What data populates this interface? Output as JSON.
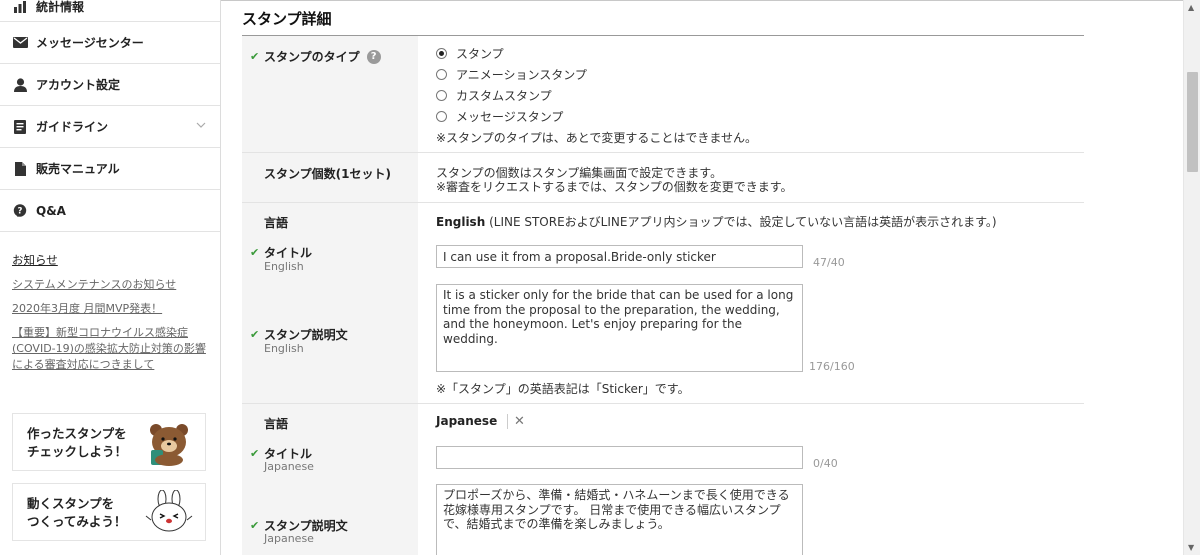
{
  "sidebar": {
    "items": [
      {
        "label": "統計情報",
        "icon": "chart-icon"
      },
      {
        "label": "メッセージセンター",
        "icon": "envelope-icon"
      },
      {
        "label": "アカウント設定",
        "icon": "user-icon"
      },
      {
        "label": "ガイドライン",
        "icon": "document-icon"
      },
      {
        "label": "販売マニュアル",
        "icon": "file-icon"
      },
      {
        "label": "Q&A",
        "icon": "qa-bubble-icon"
      }
    ],
    "notice_title": "お知らせ",
    "notices": [
      "システムメンテナンスのお知らせ",
      "2020年3月度 月間MVP発表！",
      "【重要】新型コロナウイルス感染症(COVID-19)の感染拡大防止対策の影響による審査対応につきまして"
    ],
    "promos": [
      {
        "line1": "作ったスタンプを",
        "line2": "チェックしよう！"
      },
      {
        "line1": "動くスタンプを",
        "line2": "つくってみよう！"
      }
    ]
  },
  "main": {
    "title": "スタンプ詳細",
    "type_label": "スタンプのタイプ",
    "type_options": [
      "スタンプ",
      "アニメーションスタンプ",
      "カスタムスタンプ",
      "メッセージスタンプ"
    ],
    "type_selected": "スタンプ",
    "type_note": "※スタンプのタイプは、あとで変更することはできません。",
    "count_label": "スタンプ個数(1セット)",
    "count_text1": "スタンプの個数はスタンプ編集画面で設定できます。",
    "count_text2": "※審査をリクエストするまでは、スタンプの個数を変更できます。",
    "english": {
      "lang_label": "言語",
      "lang_name": "English",
      "lang_note": "(LINE STOREおよびLINEアプリ内ショップでは、設定していない言語は英語が表示されます。)",
      "title_label": "タイトル",
      "title_sub": "English",
      "title_value": "I can use it from a proposal.Bride-only sticker",
      "title_count": "47/40",
      "desc_label": "スタンプ説明文",
      "desc_sub": "English",
      "desc_value": "It is a sticker only for the bride that can be used for a long time from the proposal to the preparation, the wedding, and the honeymoon. Let's enjoy preparing for the wedding.",
      "desc_count": "176/160",
      "desc_note": "※「スタンプ」の英語表記は「Sticker」です。"
    },
    "japanese": {
      "lang_label": "言語",
      "lang_name": "Japanese",
      "lang_remove": "✕",
      "title_label": "タイトル",
      "title_sub": "Japanese",
      "title_value": "",
      "title_count": "0/40",
      "desc_label": "スタンプ説明文",
      "desc_sub": "Japanese",
      "desc_value": "プロポーズから、準備・結婚式・ハネムーンまで長く使用できる花嫁様専用スタンプです。 日常まで使用できる幅広いスタンプで、結婚式までの準備を楽しみましょう。"
    }
  }
}
